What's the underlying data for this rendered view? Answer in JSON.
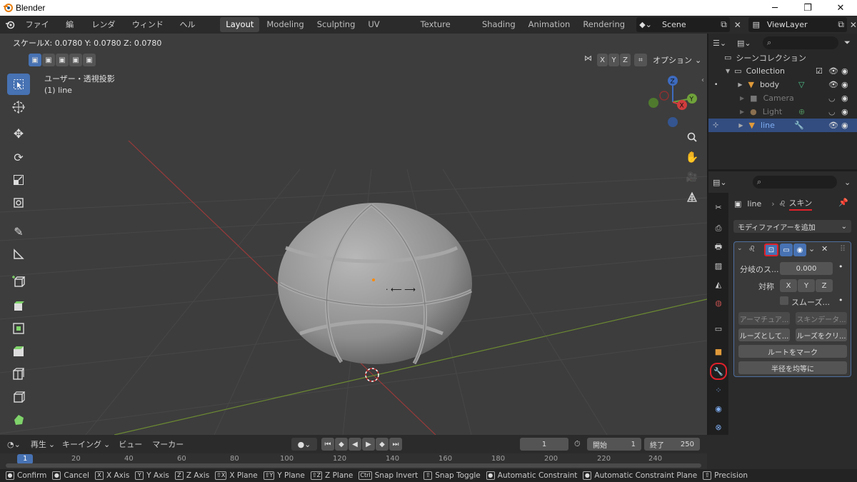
{
  "window": {
    "title": "Blender",
    "minimize": "─",
    "maximize": "❐",
    "close": "✕"
  },
  "menu": [
    "ファイル",
    "編集",
    "レンダー",
    "ウィンドウ",
    "ヘルプ"
  ],
  "workspaces": [
    "Layout",
    "Modeling",
    "Sculpting",
    "UV Editing",
    "Texture Paint",
    "Shading",
    "Animation",
    "Rendering"
  ],
  "active_workspace": "Layout",
  "scene": {
    "name": "Scene"
  },
  "view_layer": {
    "name": "ViewLayer"
  },
  "viewport": {
    "header_status": "スケールX: 0.0780   Y: 0.0780   Z: 0.0780",
    "view_name": "ユーザー・透視投影",
    "active_object": "(1) line",
    "options_label": "オプション",
    "axis_x": "X",
    "axis_y": "Y",
    "axis_z": "Z",
    "gizmo": {
      "x": "X",
      "y": "Y",
      "z": "Z"
    }
  },
  "outliner": {
    "scene_collection": "シーンコレクション",
    "collection": "Collection",
    "objects": [
      {
        "name": "body",
        "selected": false,
        "dim": false
      },
      {
        "name": "Camera",
        "selected": false,
        "dim": true
      },
      {
        "name": "Light",
        "selected": false,
        "dim": true
      },
      {
        "name": "line",
        "selected": true,
        "dim": false
      }
    ]
  },
  "properties": {
    "breadcrumb_object": "line",
    "breadcrumb_modifier": "スキン",
    "add_modifier": "モディファイアーを追加",
    "branch_smoothing_label": "分岐のス...",
    "branch_smoothing_value": "0.000",
    "symmetry_label": "対称",
    "sym_x": "X",
    "sym_y": "Y",
    "sym_z": "Z",
    "smooth_shading": "スムーズ...",
    "create_armature": "アーマチュア...",
    "skin_data": "スキンデータ...",
    "mark_loose": "ルーズとして...",
    "clear_loose": "ルーズをクリ...",
    "mark_root": "ルートをマーク",
    "equalize_radii": "半径を均等に"
  },
  "timeline": {
    "playback": "再生",
    "keying": "キーイング",
    "view": "ビュー",
    "marker": "マーカー",
    "current_frame": "1",
    "start_label": "開始",
    "start_value": "1",
    "end_label": "終了",
    "end_value": "250",
    "ticks": [
      "1",
      "20",
      "40",
      "60",
      "80",
      "100",
      "120",
      "140",
      "160",
      "180",
      "200",
      "220",
      "240"
    ]
  },
  "statusbar": [
    {
      "key": "●",
      "label": "Confirm"
    },
    {
      "key": "●",
      "label": "Cancel"
    },
    {
      "key": "X",
      "label": "X Axis"
    },
    {
      "key": "Y",
      "label": "Y Axis"
    },
    {
      "key": "Z",
      "label": "Z Axis"
    },
    {
      "key": "⇧X",
      "label": "X Plane"
    },
    {
      "key": "⇧Y",
      "label": "Y Plane"
    },
    {
      "key": "⇧Z",
      "label": "Z Plane"
    },
    {
      "key": "Ctrl",
      "label": "Snap Invert"
    },
    {
      "key": "⇧",
      "label": "Snap Toggle"
    },
    {
      "key": "●",
      "label": "Automatic Constraint"
    },
    {
      "key": "●",
      "label": "Automatic Constraint Plane"
    },
    {
      "key": "⇧",
      "label": "Precision"
    }
  ],
  "colors": {
    "accent": "#4772b3",
    "selected_row": "#334d80",
    "annotation": "#e0202a",
    "viewport_bg": "#3d3d3d"
  }
}
